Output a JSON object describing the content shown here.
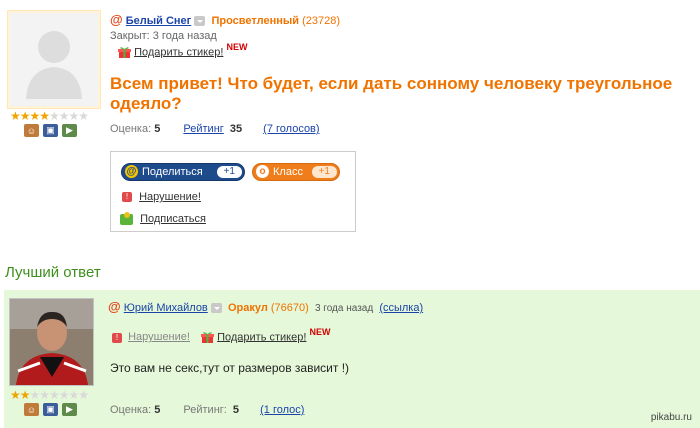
{
  "question": {
    "user": {
      "name": "Белый Снег",
      "rank": "Просветленный",
      "points": "(23728)"
    },
    "closed": "Закрыт: 3 года назад",
    "gift_sticker": "Подарить стикер!",
    "new_badge": "NEW",
    "text": "Всем привет! Что будет, если дать сонному человеку треугольное одеяло?",
    "rating_stars": 3,
    "rating_total": 5,
    "score_label": "Оценка:",
    "score_value": "5",
    "rating_label": "Рейтинг",
    "rating_value": "35",
    "votes": "(7 голосов)"
  },
  "share_box": {
    "share_label": "Поделиться",
    "share_count": "+1",
    "class_label": "Класс",
    "class_count": "+1",
    "report": "Нарушение!",
    "subscribe": "Подписаться"
  },
  "best_answer": {
    "title": "Лучший ответ",
    "user": {
      "name": "Юрий Михайлов",
      "rank": "Оракул",
      "points": "(76670)"
    },
    "time": "3 года назад",
    "link": "(ссылка)",
    "report": "Нарушение!",
    "gift_sticker": "Подарить стикер!",
    "new_badge": "NEW",
    "text": "Это вам не секс,тут от размеров зависит !)",
    "rating_stars": 2,
    "rating_total": 5,
    "score_label": "Оценка:",
    "score_value": "5",
    "rating_label": "Рейтинг:",
    "rating_value": "5",
    "votes": "(1 голос)"
  },
  "watermark": "pikabu.ru",
  "colors": {
    "orange": "#f07300",
    "link": "#1a44a8",
    "green_title": "#3f8f1c",
    "answer_bg": "#e5f8d9"
  },
  "icons": [
    "at-icon",
    "dropdown-icon",
    "gift-icon",
    "report-icon",
    "subscribe-icon",
    "user-info-icon",
    "photo-icon",
    "video-icon"
  ]
}
